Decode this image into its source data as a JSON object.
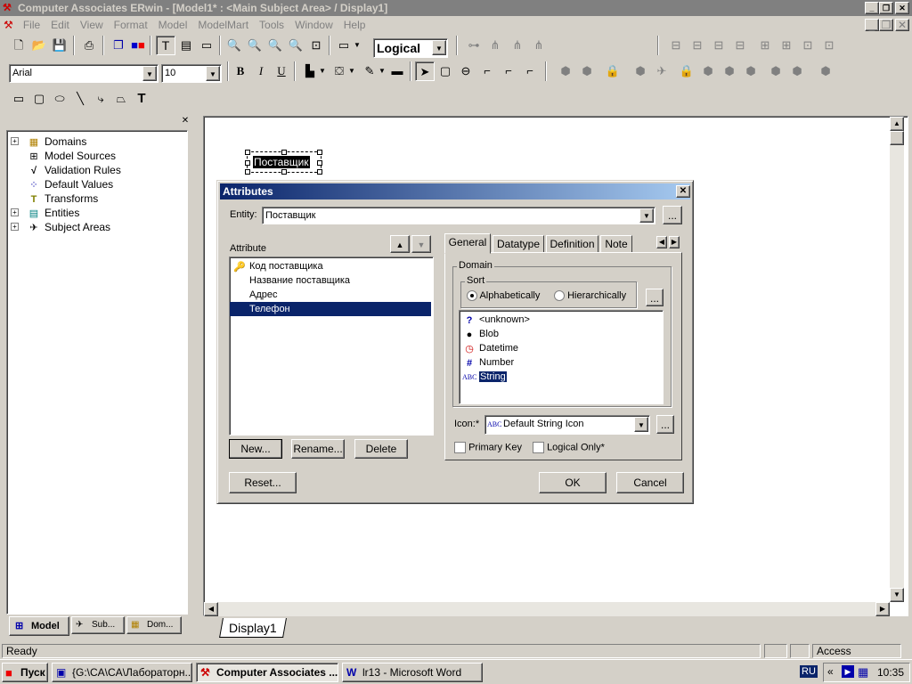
{
  "window": {
    "title": "Computer Associates ERwin - [Model1* : <Main Subject Area> / Display1]"
  },
  "menu": [
    "File",
    "Edit",
    "View",
    "Format",
    "Model",
    "ModelMart",
    "Tools",
    "Window",
    "Help"
  ],
  "toolbar": {
    "view_mode": "Logical",
    "font_name": "Arial",
    "font_size": "10"
  },
  "tree": {
    "items": [
      {
        "label": "Domains",
        "icon": "domains-icon",
        "expandable": true
      },
      {
        "label": "Model Sources",
        "icon": "model-sources-icon",
        "expandable": false
      },
      {
        "label": "Validation Rules",
        "icon": "validation-rules-icon",
        "expandable": false
      },
      {
        "label": "Default Values",
        "icon": "default-values-icon",
        "expandable": false
      },
      {
        "label": "Transforms",
        "icon": "transforms-icon",
        "expandable": false
      },
      {
        "label": "Entities",
        "icon": "entities-icon",
        "expandable": true
      },
      {
        "label": "Subject Areas",
        "icon": "subject-areas-icon",
        "expandable": true
      }
    ],
    "tabs": [
      "Model",
      "Sub...",
      "Dom..."
    ]
  },
  "canvas": {
    "entity_label": "Поставщик",
    "display_tab": "Display1"
  },
  "dialog": {
    "title": "Attributes",
    "entity_label": "Entity:",
    "entity_value": "Поставщик",
    "attribute_label": "Attribute",
    "attributes": [
      {
        "name": "Код поставщика",
        "key": true
      },
      {
        "name": "Название поставщика",
        "key": false
      },
      {
        "name": "Адрес",
        "key": false
      },
      {
        "name": "Телефон",
        "key": false,
        "selected": true
      }
    ],
    "buttons": {
      "new": "New...",
      "rename": "Rename...",
      "delete": "Delete",
      "reset": "Reset...",
      "ok": "OK",
      "cancel": "Cancel",
      "more": "..."
    },
    "tabs": [
      "General",
      "Datatype",
      "Definition",
      "Note"
    ],
    "domain_label": "Domain",
    "sort_label": "Sort",
    "sort_alpha": "Alphabetically",
    "sort_hier": "Hierarchically",
    "domains": [
      {
        "name": "<unknown>",
        "icon": "?"
      },
      {
        "name": "Blob",
        "icon": "●"
      },
      {
        "name": "Datetime",
        "icon": "◷"
      },
      {
        "name": "Number",
        "icon": "#"
      },
      {
        "name": "String",
        "icon": "ABC",
        "selected": true
      }
    ],
    "icon_label": "Icon:*",
    "icon_value": "Default String Icon",
    "primary_key": "Primary Key",
    "logical_only": "Logical Only*"
  },
  "status": {
    "left": "Ready",
    "right": "Access"
  },
  "taskbar": {
    "start": "Пуск",
    "tasks": [
      "{G:\\CA\\CA\\Лабораторн...",
      "Computer Associates ...",
      "lr13 - Microsoft Word"
    ],
    "lang": "RU",
    "time": "10:35"
  },
  "colors": {
    "selection": "#0a246a",
    "title_active": "#0a246a",
    "title_inactive": "#808080"
  }
}
